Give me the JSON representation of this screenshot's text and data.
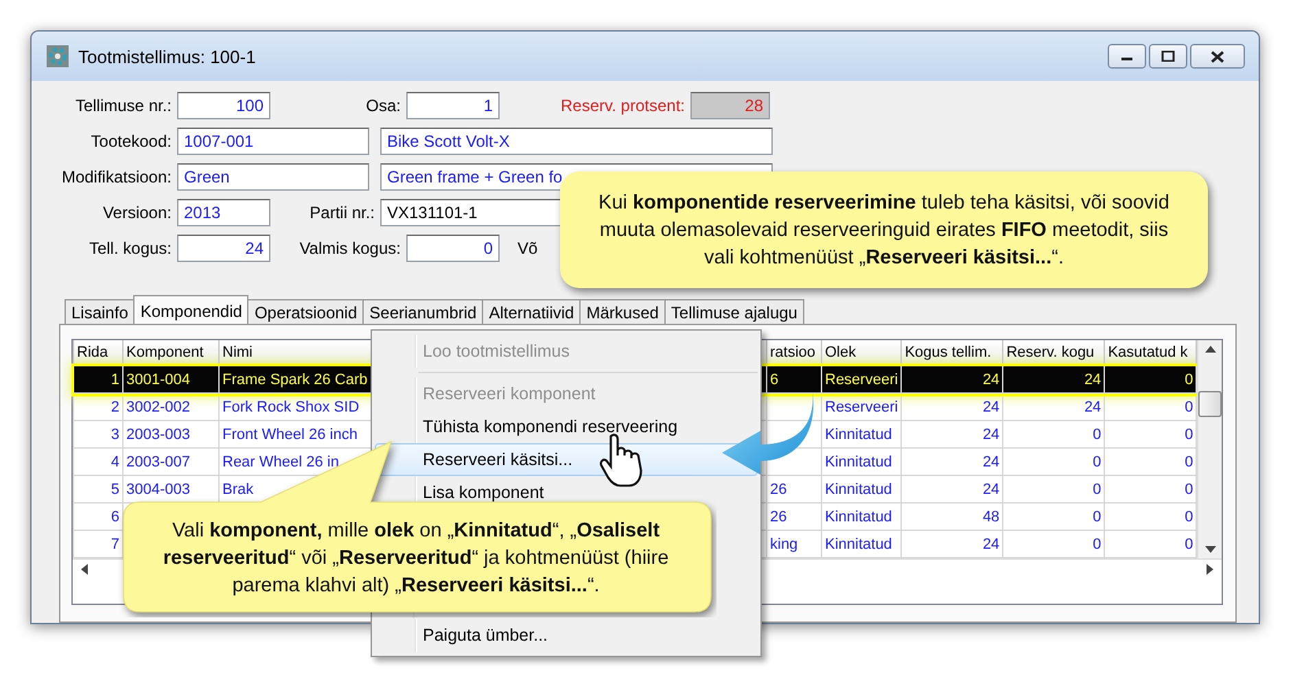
{
  "window": {
    "title": "Tootmistellimus: 100-1"
  },
  "form": {
    "rows": [
      {
        "fields": [
          {
            "label": "Tellimuse nr.:",
            "value": "100",
            "kind": "number"
          },
          {
            "label": "Osa:",
            "value": "1",
            "kind": "number"
          },
          {
            "label": "Reserv. protsent:",
            "value": "28",
            "kind": "number",
            "readonly": true
          }
        ]
      },
      {
        "fields": [
          {
            "label": "Tootekood:",
            "value": "1007-001",
            "kind": "text"
          },
          {
            "value": "Bike Scott Volt-X",
            "kind": "text"
          }
        ]
      },
      {
        "fields": [
          {
            "label": "Modifikatsioon:",
            "value": "Green",
            "kind": "text"
          },
          {
            "value": "Green frame + Green fo",
            "kind": "text"
          }
        ]
      },
      {
        "fields": [
          {
            "label": "Versioon:",
            "value": "2013",
            "kind": "text"
          },
          {
            "label": "Partii nr.:",
            "value": "VX131101-1",
            "kind": "plain"
          }
        ]
      },
      {
        "fields": [
          {
            "label": "Tell. kogus:",
            "value": "24",
            "kind": "number"
          },
          {
            "label": "Valmis kogus:",
            "value": "0",
            "kind": "number"
          },
          {
            "label": "Võ",
            "kind": "label"
          }
        ]
      }
    ]
  },
  "tabs": [
    {
      "label": "Lisainfo",
      "selected": false
    },
    {
      "label": "Komponendid",
      "selected": true
    },
    {
      "label": "Operatsioonid",
      "selected": false
    },
    {
      "label": "Seerianumbrid",
      "selected": false
    },
    {
      "label": "Alternatiivid",
      "selected": false
    },
    {
      "label": "Märkused",
      "selected": false
    },
    {
      "label": "Tellimuse ajalugu",
      "selected": false
    }
  ],
  "table": {
    "columns": [
      {
        "label": "Rida",
        "kind": "number"
      },
      {
        "label": "Komponent",
        "kind": "text"
      },
      {
        "label": "Nimi",
        "kind": "text"
      },
      {
        "label": "ratsioo",
        "kind": "text"
      },
      {
        "label": "Olek",
        "kind": "text"
      },
      {
        "label": "Kogus tellim.",
        "kind": "number"
      },
      {
        "label": "Reserv. kogu",
        "kind": "number"
      },
      {
        "label": "Kasutatud k",
        "kind": "number"
      }
    ],
    "rows": [
      {
        "selected": true,
        "cells": [
          "1",
          "3001-004",
          "Frame Spark 26 Carb",
          "6",
          "Reserveeri",
          "24",
          "24",
          "0"
        ]
      },
      {
        "selected": false,
        "cells": [
          "2",
          "3002-002",
          "Fork Rock Shox SID",
          null,
          "Reserveeri",
          "24",
          "24",
          "0"
        ]
      },
      {
        "selected": false,
        "cells": [
          "3",
          "2003-003",
          "Front Wheel 26 inch",
          null,
          "Kinnitatud",
          "24",
          "0",
          "0"
        ]
      },
      {
        "selected": false,
        "cells": [
          "4",
          "2003-007",
          "Rear Wheel 26 in",
          null,
          "Kinnitatud",
          "24",
          "0",
          "0"
        ]
      },
      {
        "selected": false,
        "cells": [
          "5",
          "3004-003",
          "Brak",
          "26",
          "Kinnitatud",
          "24",
          "0",
          "0"
        ]
      },
      {
        "selected": false,
        "cells": [
          "6",
          null,
          null,
          "26",
          "Kinnitatud",
          "48",
          "0",
          "0"
        ]
      },
      {
        "selected": false,
        "cells": [
          "7",
          null,
          null,
          "king",
          "Kinnitatud",
          "24",
          "0",
          "0"
        ]
      }
    ]
  },
  "context_menu": {
    "items": [
      {
        "label": "Loo tootmistellimus",
        "disabled": true,
        "selected": false
      },
      {
        "kind": "separator"
      },
      {
        "label": "Reserveeri komponent",
        "disabled": true,
        "selected": false
      },
      {
        "label": "Tühista komponendi reserveering",
        "disabled": false,
        "selected": false
      },
      {
        "label": "Reserveeri käsitsi...",
        "disabled": false,
        "selected": true
      },
      {
        "label": "Lisa komponent",
        "disabled": false,
        "selected": false
      },
      {
        "kind": "gap"
      },
      {
        "label": "Paiguta ümber...",
        "disabled": false,
        "selected": false
      }
    ]
  },
  "callouts": [
    {
      "text": "Kui **komponentide reserveerimine** tuleb teha käsitsi, või soovid muuta olemasolevaid reserveeringuid eirates **FIFO** meetodit, siis vali kohtmenüüst „**Reserveeri käsitsi...**“."
    },
    {
      "text": "Vali **komponent,** mille **olek** on „**Kinnitatud**“, „**Osaliselt reserveeritud**“ või „**Reserveeritud**“ ja kohtmenüüst (hiire parema klahvi alt) „**Reserveeri käsitsi...**“."
    }
  ]
}
